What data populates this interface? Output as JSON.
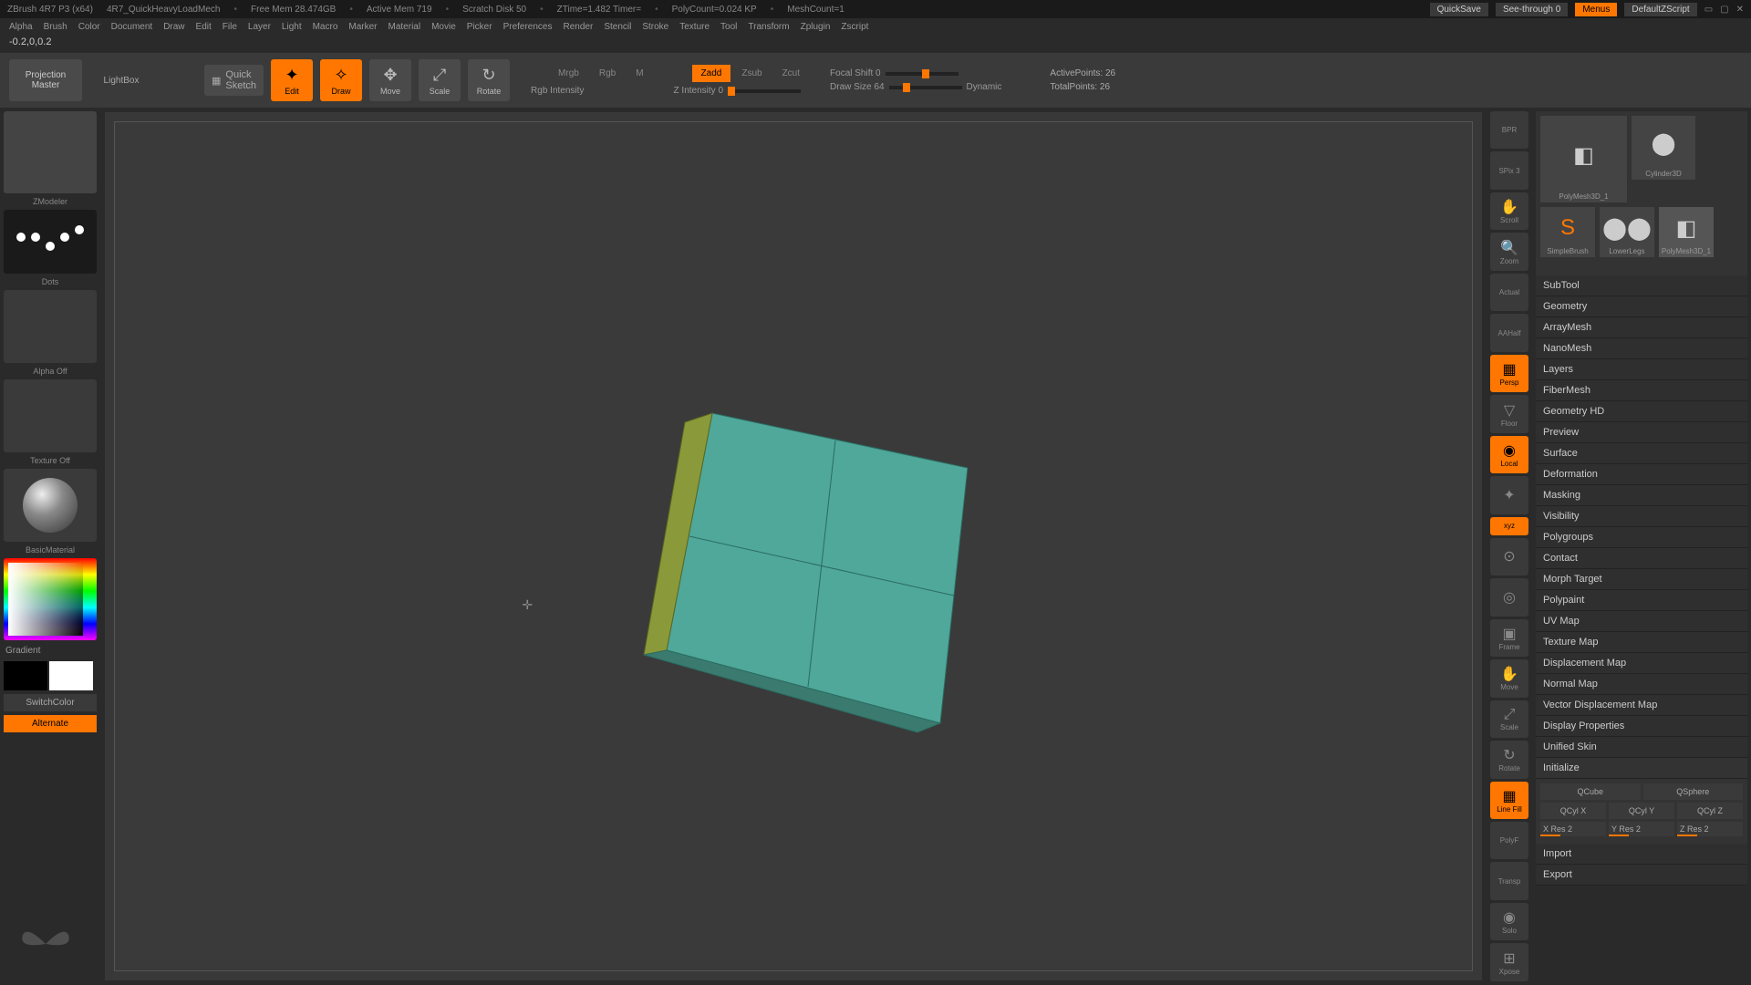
{
  "title": {
    "app": "ZBrush 4R7 P3 (x64)",
    "doc": "4R7_QuickHeavyLoadMech",
    "mem": "Free Mem 28.474GB",
    "active": "Active Mem 719",
    "scratch": "Scratch Disk 50",
    "ztime": "ZTime=1.482 Timer=",
    "poly": "PolyCount=0.024 KP",
    "mesh": "MeshCount=1"
  },
  "titleright": {
    "quicksave": "QuickSave",
    "see": "See-through",
    "seeval": "0",
    "menus": "Menus",
    "script": "DefaultZScript"
  },
  "menu": [
    "Alpha",
    "Brush",
    "Color",
    "Document",
    "Draw",
    "Edit",
    "File",
    "Layer",
    "Light",
    "Macro",
    "Marker",
    "Material",
    "Movie",
    "Picker",
    "Preferences",
    "Render",
    "Stencil",
    "Stroke",
    "Texture",
    "Tool",
    "Transform",
    "Zplugin",
    "Zscript"
  ],
  "status": "-0.2,0,0.2",
  "shelf": {
    "proj": "Projection\nMaster",
    "lightbox": "LightBox",
    "quick": "Quick\nSketch",
    "edit": "Edit",
    "draw": "Draw",
    "move": "Move",
    "scale": "Scale",
    "rotate": "Rotate"
  },
  "modes": {
    "mrgb": "Mrgb",
    "rgb": "Rgb",
    "m": "M",
    "zadd": "Zadd",
    "zsub": "Zsub",
    "zcut": "Zcut"
  },
  "sliders": {
    "rgbint": "Rgb Intensity",
    "zint": "Z Intensity 0",
    "focal": "Focal Shift 0",
    "draw": "Draw Size 64",
    "dynamic": "Dynamic"
  },
  "info": {
    "active": "ActivePoints: 26",
    "total": "TotalPoints: 26"
  },
  "left": {
    "brush": "ZModeler",
    "stroke": "Dots",
    "alpha": "Alpha Off",
    "texture": "Texture Off",
    "material": "BasicMaterial",
    "gradient": "Gradient",
    "switch": "SwitchColor",
    "alt": "Alternate"
  },
  "rightbtns": [
    "BPR",
    "SPix 3",
    "Scroll",
    "Zoom",
    "Actual",
    "AAHalf",
    "Persp",
    "",
    "Floor",
    "Local",
    "",
    "xyz",
    "",
    "",
    "Frame",
    "Move",
    "Scale",
    "Rotate",
    "Line Fill",
    "PolyF",
    "Transp",
    "",
    "Solo",
    "Xpose"
  ],
  "tools": [
    {
      "name": "PolyMesh3D_1",
      "icon": "◧"
    },
    {
      "name": "Cylinder3D",
      "icon": "⬤"
    },
    {
      "name": "SimpleBrush",
      "icon": "S"
    },
    {
      "name": "LowerLegs",
      "icon": "⬤⬤"
    },
    {
      "name": "PolyMesh3D_1",
      "icon": "◧"
    }
  ],
  "sections": [
    "SubTool",
    "Geometry",
    "ArrayMesh",
    "NanoMesh",
    "Layers",
    "FiberMesh",
    "Geometry HD",
    "Preview",
    "Surface",
    "Deformation",
    "Masking",
    "Visibility",
    "Polygroups",
    "Contact",
    "Morph Target",
    "Polypaint",
    "UV Map",
    "Texture Map",
    "Displacement Map",
    "Normal Map",
    "Vector Displacement Map",
    "Display Properties",
    "Unified Skin"
  ],
  "init": {
    "label": "Initialize",
    "qcube": "QCube",
    "qsphere": "QSphere",
    "qcylx": "QCyl X",
    "qcyly": "QCyl Y",
    "qcylz": "QCyl Z",
    "xres": "X Res 2",
    "yres": "Y Res 2",
    "zres": "Z Res 2",
    "import": "Import",
    "export": "Export"
  }
}
